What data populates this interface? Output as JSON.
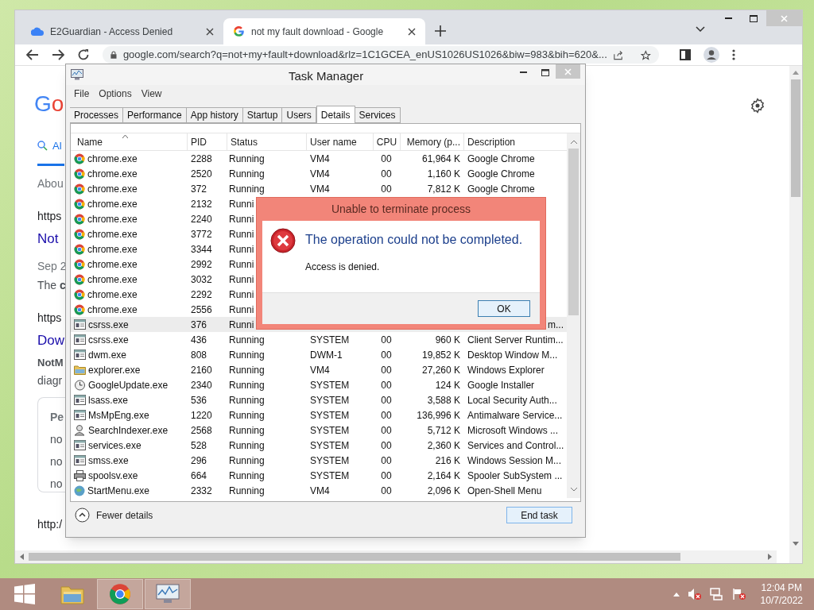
{
  "browser": {
    "tabs": [
      {
        "title": "E2Guardian - Access Denied",
        "selected": false
      },
      {
        "title": "not my fault download - Google",
        "selected": true
      }
    ],
    "url": "google.com/search?q=not+my+fault+download&rlz=1C1GCEA_enUS1026US1026&biw=983&bih=620&...",
    "page": {
      "logo": "Go",
      "nav_tab": "Al",
      "fragments": [
        {
          "kind": "meta",
          "text": "Abou"
        },
        {
          "kind": "url",
          "text": "https"
        },
        {
          "kind": "title",
          "text": "Not"
        },
        {
          "kind": "meta",
          "text": "Sep 2"
        },
        {
          "kind": "snippet",
          "text": "The **c**"
        },
        {
          "kind": "url",
          "text": "https"
        },
        {
          "kind": "title",
          "text": "Dow"
        },
        {
          "kind": "strong",
          "text": "NotM"
        },
        {
          "kind": "snippet",
          "text": "diagr"
        }
      ],
      "card": {
        "heading": "Pe",
        "lines": [
          "no",
          "no",
          "no"
        ]
      },
      "footer_url": "http:/"
    }
  },
  "task_manager": {
    "title": "Task Manager",
    "menu": [
      "File",
      "Options",
      "View"
    ],
    "tabs": [
      {
        "label": "Processes",
        "selected": false
      },
      {
        "label": "Performance",
        "selected": false
      },
      {
        "label": "App history",
        "selected": false
      },
      {
        "label": "Startup",
        "selected": false
      },
      {
        "label": "Users",
        "selected": false
      },
      {
        "label": "Details",
        "selected": true
      },
      {
        "label": "Services",
        "selected": false
      }
    ],
    "columns": [
      {
        "label": "Name",
        "sorted": true
      },
      {
        "label": "PID",
        "sorted": false
      },
      {
        "label": "Status",
        "sorted": false
      },
      {
        "label": "User name",
        "sorted": false
      },
      {
        "label": "CPU",
        "sorted": false
      },
      {
        "label": "Memory (p...",
        "sorted": false
      },
      {
        "label": "Description",
        "sorted": false
      }
    ],
    "rows": [
      {
        "kind": "chrome",
        "name": "chrome.exe",
        "pid": "2288",
        "status": "Running",
        "user": "VM4",
        "cpu": "00",
        "memory": "61,964 K",
        "description": "Google Chrome",
        "selected": false
      },
      {
        "kind": "chrome",
        "name": "chrome.exe",
        "pid": "2520",
        "status": "Running",
        "user": "VM4",
        "cpu": "00",
        "memory": "1,160 K",
        "description": "Google Chrome",
        "selected": false
      },
      {
        "kind": "chrome",
        "name": "chrome.exe",
        "pid": "372",
        "status": "Running",
        "user": "VM4",
        "cpu": "00",
        "memory": "7,812 K",
        "description": "Google Chrome",
        "selected": false
      },
      {
        "kind": "chrome",
        "name": "chrome.exe",
        "pid": "2132",
        "status": "Runni",
        "selected": false
      },
      {
        "kind": "chrome",
        "name": "chrome.exe",
        "pid": "2240",
        "status": "Runni",
        "selected": false
      },
      {
        "kind": "chrome",
        "name": "chrome.exe",
        "pid": "3772",
        "status": "Runni",
        "selected": false
      },
      {
        "kind": "chrome",
        "name": "chrome.exe",
        "pid": "3344",
        "status": "Runni",
        "selected": false
      },
      {
        "kind": "chrome",
        "name": "chrome.exe",
        "pid": "2992",
        "status": "Runni",
        "selected": false
      },
      {
        "kind": "chrome",
        "name": "chrome.exe",
        "pid": "3032",
        "status": "Runni",
        "selected": false
      },
      {
        "kind": "chrome",
        "name": "chrome.exe",
        "pid": "2292",
        "status": "Runni",
        "selected": false
      },
      {
        "kind": "chrome",
        "name": "chrome.exe",
        "pid": "2556",
        "status": "Runni",
        "selected": false
      },
      {
        "kind": "app",
        "name": "csrss.exe",
        "pid": "376",
        "status": "Runni",
        "description_tail": "m...",
        "selected": true
      },
      {
        "kind": "app",
        "name": "csrss.exe",
        "pid": "436",
        "status": "Running",
        "user": "SYSTEM",
        "cpu": "00",
        "memory": "960 K",
        "description": "Client Server Runtim...",
        "selected": false
      },
      {
        "kind": "app",
        "name": "dwm.exe",
        "pid": "808",
        "status": "Running",
        "user": "DWM-1",
        "cpu": "00",
        "memory": "19,852 K",
        "description": "Desktop Window M...",
        "selected": false
      },
      {
        "kind": "folder",
        "name": "explorer.exe",
        "pid": "2160",
        "status": "Running",
        "user": "VM4",
        "cpu": "00",
        "memory": "27,260 K",
        "description": "Windows Explorer",
        "selected": false
      },
      {
        "kind": "update",
        "name": "GoogleUpdate.exe",
        "pid": "2340",
        "status": "Running",
        "user": "SYSTEM",
        "cpu": "00",
        "memory": "124 K",
        "description": "Google Installer",
        "selected": false
      },
      {
        "kind": "app",
        "name": "lsass.exe",
        "pid": "536",
        "status": "Running",
        "user": "SYSTEM",
        "cpu": "00",
        "memory": "3,588 K",
        "description": "Local Security Auth...",
        "selected": false
      },
      {
        "kind": "app",
        "name": "MsMpEng.exe",
        "pid": "1220",
        "status": "Running",
        "user": "SYSTEM",
        "cpu": "00",
        "memory": "136,996 K",
        "description": "Antimalware Service...",
        "selected": false
      },
      {
        "kind": "indexer",
        "name": "SearchIndexer.exe",
        "pid": "2568",
        "status": "Running",
        "user": "SYSTEM",
        "cpu": "00",
        "memory": "5,712 K",
        "description": "Microsoft Windows ...",
        "selected": false
      },
      {
        "kind": "app",
        "name": "services.exe",
        "pid": "528",
        "status": "Running",
        "user": "SYSTEM",
        "cpu": "00",
        "memory": "2,360 K",
        "description": "Services and Control...",
        "selected": false
      },
      {
        "kind": "app",
        "name": "smss.exe",
        "pid": "296",
        "status": "Running",
        "user": "SYSTEM",
        "cpu": "00",
        "memory": "216 K",
        "description": "Windows Session M...",
        "selected": false
      },
      {
        "kind": "printer",
        "name": "spoolsv.exe",
        "pid": "664",
        "status": "Running",
        "user": "SYSTEM",
        "cpu": "00",
        "memory": "2,164 K",
        "description": "Spooler SubSystem ...",
        "selected": false
      },
      {
        "kind": "shell",
        "name": "StartMenu.exe",
        "pid": "2332",
        "status": "Running",
        "user": "VM4",
        "cpu": "00",
        "memory": "2,096 K",
        "description": "Open-Shell Menu",
        "selected": false
      }
    ],
    "fewer_details": "Fewer details",
    "end_task": "End task"
  },
  "dialog": {
    "title": "Unable to terminate process",
    "heading": "The operation could not be completed.",
    "message": "Access is denied.",
    "ok": "OK"
  },
  "taskbar": {
    "items": [
      {
        "kind": "start",
        "running": false
      },
      {
        "kind": "explorer",
        "running": false
      },
      {
        "kind": "chrome",
        "running": true
      },
      {
        "kind": "taskmgr",
        "running": true
      }
    ],
    "time": "12:04 PM",
    "date": "10/7/2022"
  }
}
